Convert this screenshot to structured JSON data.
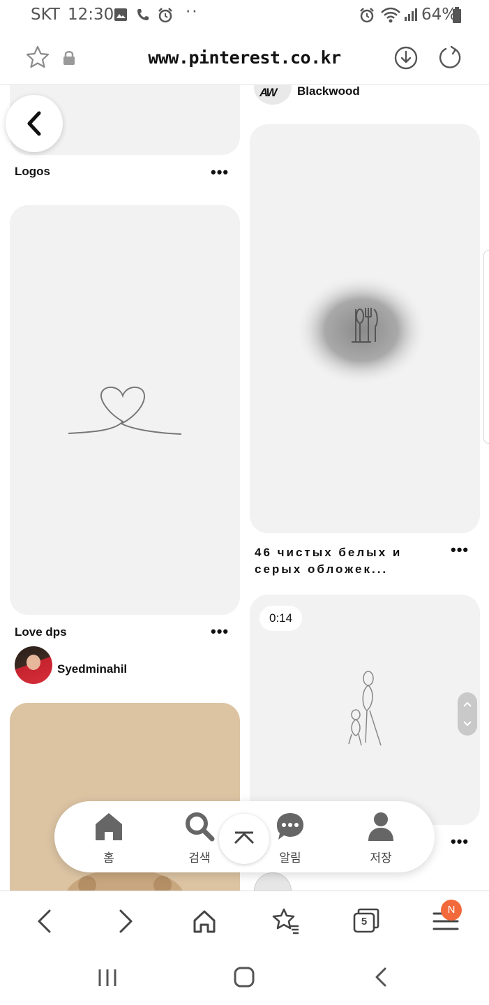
{
  "status_bar": {
    "carrier": "SKT",
    "time": "12:30",
    "battery": "64%",
    "icons": [
      "gallery-icon",
      "phone-icon",
      "alarm-icon",
      "more-dots-icon",
      "alarm-icon",
      "wifi-icon",
      "signal-icon",
      "battery-icon"
    ]
  },
  "address_bar": {
    "url": "www.pinterest.co.kr",
    "icons": [
      "bookmark-star-icon",
      "lock-icon",
      "download-icon",
      "reload-icon"
    ]
  },
  "feed": {
    "left": [
      {
        "title": "Logos"
      },
      {
        "title": "Love dps",
        "owner": "Syedminahil"
      },
      {
        "title": ""
      }
    ],
    "right": [
      {
        "owner": "Blackwood",
        "owner_logo": "AW"
      },
      {
        "title": "46 чистых белых и серых обложек..."
      },
      {
        "video_duration": "0:14"
      }
    ]
  },
  "pin_nav": {
    "items": [
      {
        "label": "홈",
        "icon": "home-icon"
      },
      {
        "label": "검색",
        "icon": "search-icon"
      },
      {
        "label": "알림",
        "icon": "chat-bubble-icon"
      },
      {
        "label": "저장",
        "icon": "profile-icon"
      }
    ]
  },
  "browser_toolbar": {
    "tab_count": "5",
    "menu_badge": "N"
  },
  "colors": {
    "accent_badge": "#f26a3b",
    "card_bg": "#f2f2f2",
    "tan_card": "#dcc4a3"
  }
}
